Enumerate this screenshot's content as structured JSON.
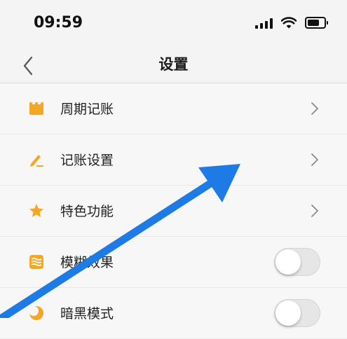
{
  "status_bar": {
    "time": "09:59",
    "icons": [
      "signal-icon",
      "wifi-icon",
      "battery-icon"
    ]
  },
  "nav": {
    "title": "设置",
    "back_icon": "chevron-left-icon"
  },
  "settings": [
    {
      "label": "周期记账",
      "icon": "calendar-icon",
      "accessory": "chevron"
    },
    {
      "label": "记账设置",
      "icon": "pencil-icon",
      "accessory": "chevron"
    },
    {
      "label": "特色功能",
      "icon": "star-icon",
      "accessory": "chevron"
    },
    {
      "label": "模糊效果",
      "icon": "waves-icon",
      "accessory": "toggle",
      "on": false
    },
    {
      "label": "暗黑模式",
      "icon": "moon-icon",
      "accessory": "toggle",
      "on": false
    }
  ],
  "colors": {
    "icon_orange": "#f5a623",
    "annotation_arrow": "#1e7be6"
  }
}
